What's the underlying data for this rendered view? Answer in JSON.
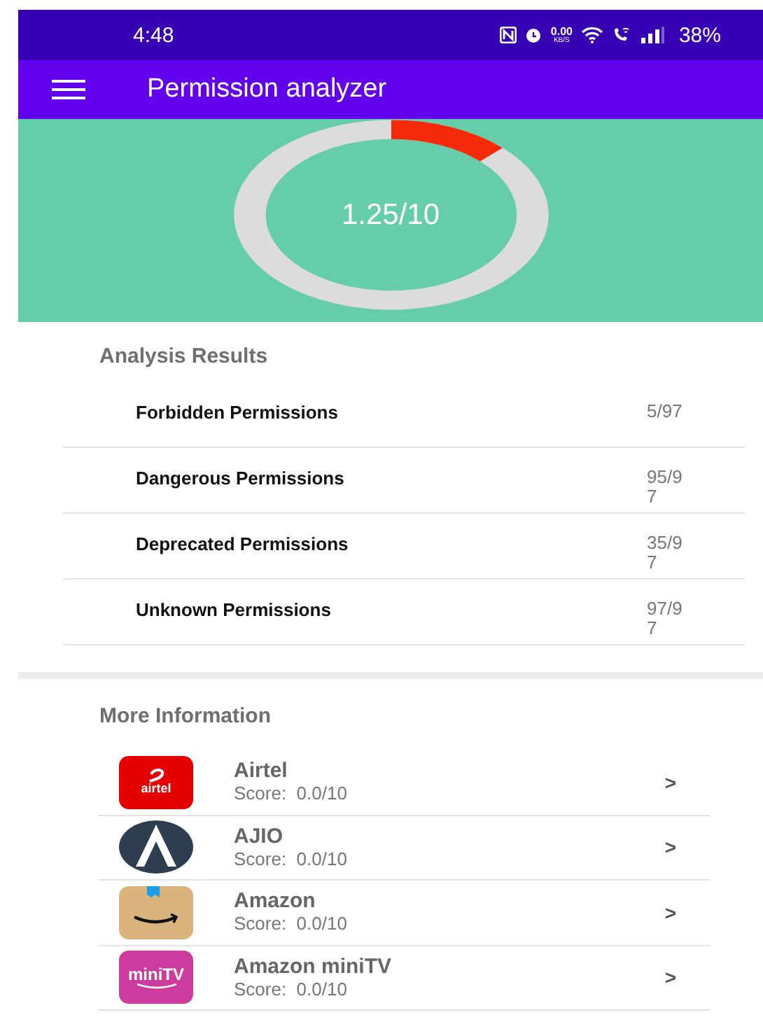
{
  "status_bar": {
    "time": "4:48",
    "net_speed": "0.00",
    "net_unit": "KB/S",
    "battery": "38%"
  },
  "app_bar": {
    "title": "Permission analyzer"
  },
  "score": {
    "text": "1.25/10",
    "level": 0.125
  },
  "analysis": {
    "heading": "Analysis Results",
    "rows": [
      {
        "label": "Forbidden Permissions",
        "value": "5/97"
      },
      {
        "label": "Dangerous Permissions",
        "value": "95/97"
      },
      {
        "label": "Deprecated Permissions",
        "value": "35/97"
      },
      {
        "label": "Unknown Permissions",
        "value": "97/97"
      }
    ]
  },
  "more_info": {
    "heading": "More Information",
    "apps": [
      {
        "kind": "airtel",
        "logo_text": "airtel",
        "name": "Airtel",
        "score": "Score:  0.0/10",
        "chevron": ">"
      },
      {
        "kind": "ajio",
        "name": "AJIO",
        "score": "Score:  0.0/10",
        "chevron": ">"
      },
      {
        "kind": "amazon",
        "name": "Amazon",
        "score": "Score:  0.0/10",
        "chevron": ">"
      },
      {
        "kind": "minitv",
        "logo_text": "miniTV",
        "name": "Amazon miniTV",
        "score": "Score:  0.0/10",
        "chevron": ">"
      }
    ]
  }
}
